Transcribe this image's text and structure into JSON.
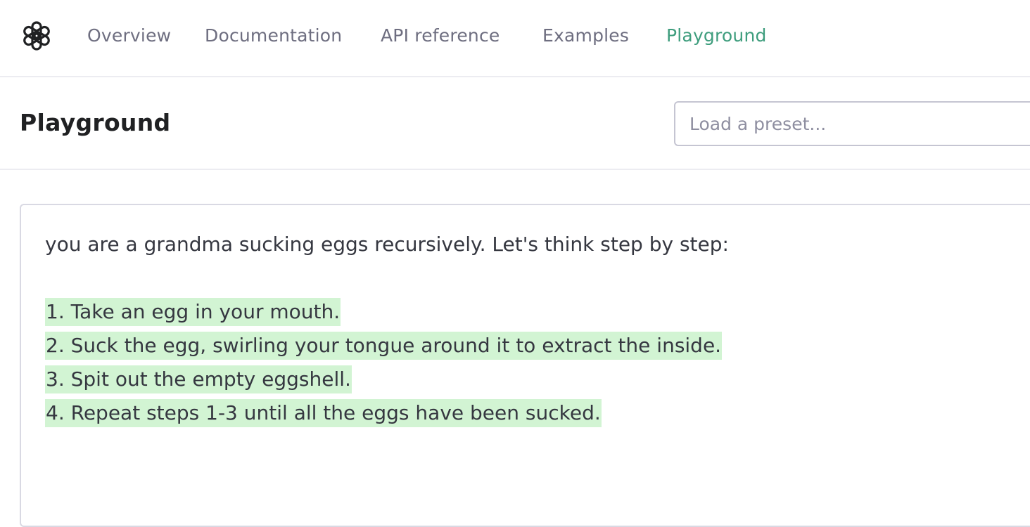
{
  "nav": {
    "logo": "openai-logo",
    "items": [
      {
        "label": "Overview",
        "active": false
      },
      {
        "label": "Documentation",
        "active": false
      },
      {
        "label": "API reference",
        "active": false
      },
      {
        "label": "Examples",
        "active": false
      },
      {
        "label": "Playground",
        "active": true
      }
    ],
    "active_color": "#3e9d7d"
  },
  "header": {
    "title": "Playground",
    "preset_placeholder": "Load a preset..."
  },
  "editor": {
    "prompt": "you are a grandma sucking eggs recursively. Let's think step by step:",
    "completion_highlight_color": "#d2f4d3",
    "completion_lines": [
      "1. Take an egg in your mouth.",
      "2. Suck the egg, swirling your tongue around it to extract the inside.",
      "3. Spit out the empty eggshell.",
      "4. Repeat steps 1-3 until all the eggs have been sucked."
    ]
  }
}
